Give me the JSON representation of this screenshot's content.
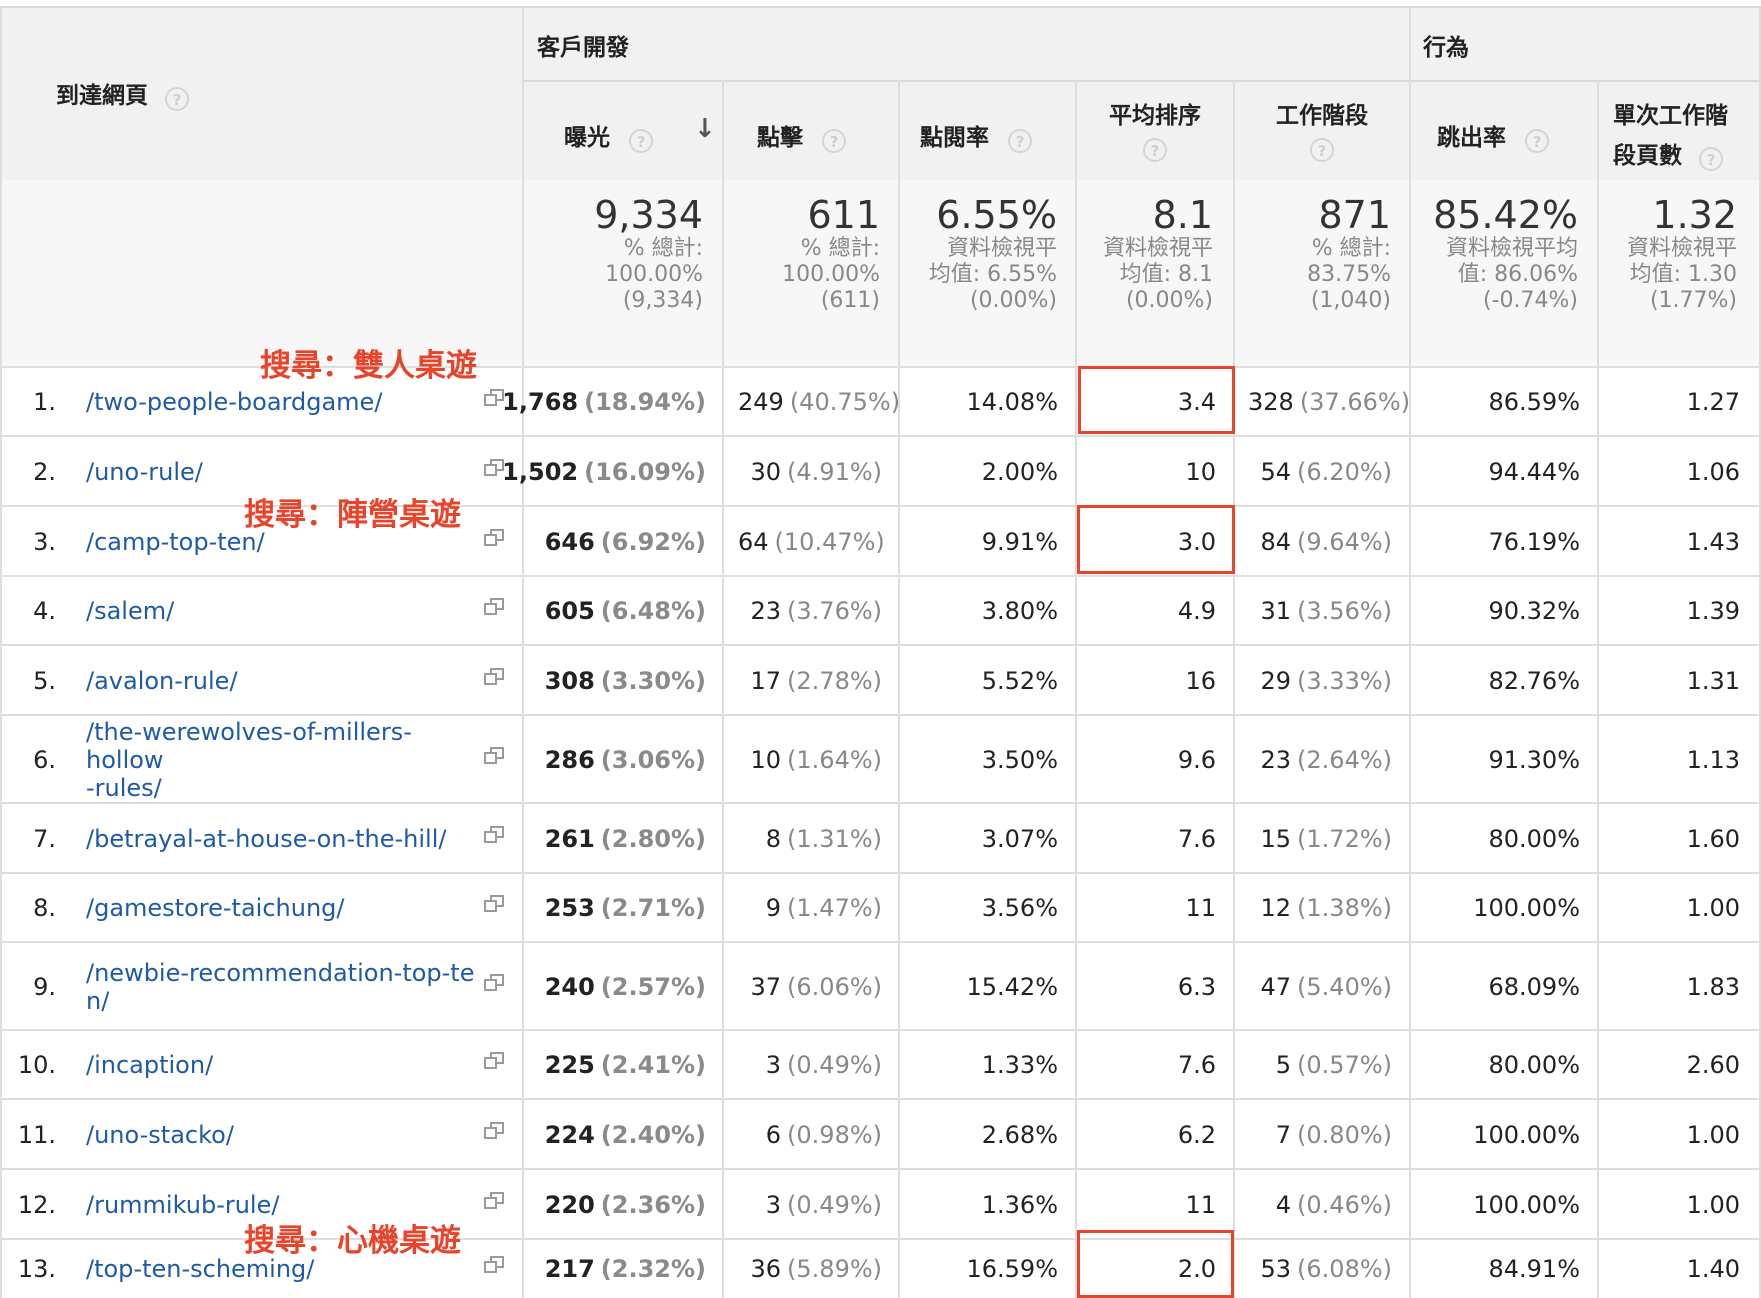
{
  "header": {
    "landing_page": "到達網頁",
    "group_acquisition": "客戶開發",
    "group_behavior": "行為",
    "col_impressions": "曝光",
    "col_clicks": "點擊",
    "col_ctr": "點閱率",
    "col_avg_position": "平均排序",
    "col_sessions": "工作階段",
    "col_bounce_rate": "跳出率",
    "col_pages_per_session_1": "單次工作階",
    "col_pages_per_session_2": "段頁數",
    "help_glyph": "?",
    "sort_glyph": "↓"
  },
  "summary": {
    "impressions": {
      "big": "9,334",
      "l1": "% 總計:",
      "l2": "100.00%",
      "l3": "(9,334)"
    },
    "clicks": {
      "big": "611",
      "l1": "% 總計:",
      "l2": "100.00%",
      "l3": "(611)"
    },
    "ctr": {
      "big": "6.55%",
      "l1": "資料檢視平",
      "l2": "均值: 6.55%",
      "l3": "(0.00%)"
    },
    "avg_position": {
      "big": "8.1",
      "l1": "資料檢視平",
      "l2": "均值: 8.1",
      "l3": "(0.00%)"
    },
    "sessions": {
      "big": "871",
      "l1": "% 總計:",
      "l2": "83.75%",
      "l3": "(1,040)"
    },
    "bounce_rate": {
      "big": "85.42%",
      "l1": "資料檢視平均",
      "l2": "值: 86.06%",
      "l3": "(-0.74%)"
    },
    "pages_per_session": {
      "big": "1.32",
      "l1": "資料檢視平",
      "l2": "均值: 1.30",
      "l3": "(1.77%)"
    }
  },
  "rows": [
    {
      "idx": "1.",
      "path1": "/two-people-boardgame/",
      "path2": "",
      "imp": "1,768",
      "imp_pct": "(18.94%)",
      "clk": "249",
      "clk_pct": "(40.75%)",
      "ctr": "14.08%",
      "pos": "3.4",
      "ses": "328",
      "ses_pct": "(37.66%)",
      "bounce": "86.59%",
      "pps": "1.27"
    },
    {
      "idx": "2.",
      "path1": "/uno-rule/",
      "path2": "",
      "imp": "1,502",
      "imp_pct": "(16.09%)",
      "clk": "30",
      "clk_pct": "(4.91%)",
      "ctr": "2.00%",
      "pos": "10",
      "ses": "54",
      "ses_pct": "(6.20%)",
      "bounce": "94.44%",
      "pps": "1.06"
    },
    {
      "idx": "3.",
      "path1": "/camp-top-ten/",
      "path2": "",
      "imp": "646",
      "imp_pct": "(6.92%)",
      "clk": "64",
      "clk_pct": "(10.47%)",
      "ctr": "9.91%",
      "pos": "3.0",
      "ses": "84",
      "ses_pct": "(9.64%)",
      "bounce": "76.19%",
      "pps": "1.43"
    },
    {
      "idx": "4.",
      "path1": "/salem/",
      "path2": "",
      "imp": "605",
      "imp_pct": "(6.48%)",
      "clk": "23",
      "clk_pct": "(3.76%)",
      "ctr": "3.80%",
      "pos": "4.9",
      "ses": "31",
      "ses_pct": "(3.56%)",
      "bounce": "90.32%",
      "pps": "1.39"
    },
    {
      "idx": "5.",
      "path1": "/avalon-rule/",
      "path2": "",
      "imp": "308",
      "imp_pct": "(3.30%)",
      "clk": "17",
      "clk_pct": "(2.78%)",
      "ctr": "5.52%",
      "pos": "16",
      "ses": "29",
      "ses_pct": "(3.33%)",
      "bounce": "82.76%",
      "pps": "1.31"
    },
    {
      "idx": "6.",
      "path1": "/the-werewolves-of-millers-hollow",
      "path2": "-rules/",
      "imp": "286",
      "imp_pct": "(3.06%)",
      "clk": "10",
      "clk_pct": "(1.64%)",
      "ctr": "3.50%",
      "pos": "9.6",
      "ses": "23",
      "ses_pct": "(2.64%)",
      "bounce": "91.30%",
      "pps": "1.13"
    },
    {
      "idx": "7.",
      "path1": "/betrayal-at-house-on-the-hill/",
      "path2": "",
      "imp": "261",
      "imp_pct": "(2.80%)",
      "clk": "8",
      "clk_pct": "(1.31%)",
      "ctr": "3.07%",
      "pos": "7.6",
      "ses": "15",
      "ses_pct": "(1.72%)",
      "bounce": "80.00%",
      "pps": "1.60"
    },
    {
      "idx": "8.",
      "path1": "/gamestore-taichung/",
      "path2": "",
      "imp": "253",
      "imp_pct": "(2.71%)",
      "clk": "9",
      "clk_pct": "(1.47%)",
      "ctr": "3.56%",
      "pos": "11",
      "ses": "12",
      "ses_pct": "(1.38%)",
      "bounce": "100.00%",
      "pps": "1.00"
    },
    {
      "idx": "9.",
      "path1": "/newbie-recommendation-top-te",
      "path2": "n/",
      "imp": "240",
      "imp_pct": "(2.57%)",
      "clk": "37",
      "clk_pct": "(6.06%)",
      "ctr": "15.42%",
      "pos": "6.3",
      "ses": "47",
      "ses_pct": "(5.40%)",
      "bounce": "68.09%",
      "pps": "1.83"
    },
    {
      "idx": "10.",
      "path1": "/incaption/",
      "path2": "",
      "imp": "225",
      "imp_pct": "(2.41%)",
      "clk": "3",
      "clk_pct": "(0.49%)",
      "ctr": "1.33%",
      "pos": "7.6",
      "ses": "5",
      "ses_pct": "(0.57%)",
      "bounce": "80.00%",
      "pps": "2.60"
    },
    {
      "idx": "11.",
      "path1": "/uno-stacko/",
      "path2": "",
      "imp": "224",
      "imp_pct": "(2.40%)",
      "clk": "6",
      "clk_pct": "(0.98%)",
      "ctr": "2.68%",
      "pos": "6.2",
      "ses": "7",
      "ses_pct": "(0.80%)",
      "bounce": "100.00%",
      "pps": "1.00"
    },
    {
      "idx": "12.",
      "path1": "/rummikub-rule/",
      "path2": "",
      "imp": "220",
      "imp_pct": "(2.36%)",
      "clk": "3",
      "clk_pct": "(0.49%)",
      "ctr": "1.36%",
      "pos": "11",
      "ses": "4",
      "ses_pct": "(0.46%)",
      "bounce": "100.00%",
      "pps": "1.00"
    },
    {
      "idx": "13.",
      "path1": "/top-ten-scheming/",
      "path2": "",
      "imp": "217",
      "imp_pct": "(2.32%)",
      "clk": "36",
      "clk_pct": "(5.89%)",
      "ctr": "16.59%",
      "pos": "2.0",
      "ses": "53",
      "ses_pct": "(6.08%)",
      "bounce": "84.91%",
      "pps": "1.40"
    }
  ],
  "annotations": {
    "a1": "搜尋：雙人桌遊",
    "a2": "搜尋：陣營桌遊",
    "a3": "搜尋：心機桌遊"
  },
  "colors": {
    "annotation_red": "#e8432b",
    "link_blue": "#1f5aa6"
  }
}
